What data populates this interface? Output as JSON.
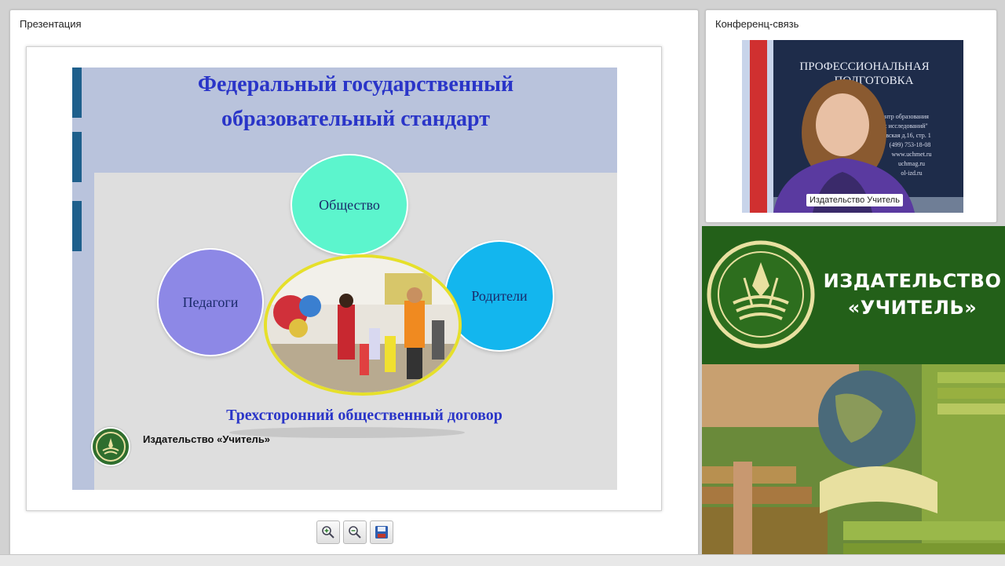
{
  "presentation_panel": {
    "title": "Презентация"
  },
  "slide": {
    "title_line1": "Федеральный государственный",
    "title_line2": "образовательный стандарт",
    "circles": {
      "society": "Общество",
      "teachers": "Педагоги",
      "parents": "Родители"
    },
    "caption": "Трехсторонний общественный договор",
    "publisher": "Издательство «Учитель»"
  },
  "toolbar": {
    "zoom_in": "zoom-in-icon",
    "zoom_out": "zoom-out-icon",
    "save": "floppy-disk-icon"
  },
  "conference_panel": {
    "title": "Конференц-связь",
    "participant_name": "Издательство Учитель",
    "banner_line1": "ПРОФЕССИОНАЛЬНАЯ",
    "banner_line2": "ПОДГОТОВКА",
    "banner_small": [
      "центр образования",
      "ых исследований\"",
      "овская д.16, стр. 1",
      "(499) 753-18-08",
      "www.uchmet.ru",
      "uchmag.ru",
      "ol-izd.ru"
    ]
  },
  "brand": {
    "line1": "ИЗДАТЕЛЬСТВО",
    "line2": "«УЧИТЕЛЬ»"
  },
  "colors": {
    "slide_title": "#2a35c8",
    "circle_society": "#5cf5cd",
    "circle_teachers": "#8d88e6",
    "circle_parents": "#13b6ee",
    "brand_green": "#236019",
    "brand_gold": "#e8e0a0"
  }
}
